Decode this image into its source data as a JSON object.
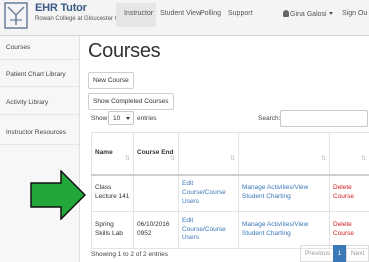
{
  "app": {
    "title": "EHR Tutor",
    "subtitle": "Rowan College at Gloucester County"
  },
  "topnav": {
    "instructor": "Instructor",
    "student_view": "Student View",
    "polling": "Polling",
    "support": "Support",
    "user_name": "Gina Galosi",
    "sign_out": "Sign Ou"
  },
  "sidebar": {
    "items": [
      {
        "label": "Courses"
      },
      {
        "label": "Patient Chart Library"
      },
      {
        "label": "Activity Library"
      },
      {
        "label": "Instructor Resources"
      }
    ]
  },
  "main": {
    "title": "Courses",
    "new_course_label": "New Course",
    "show_completed_label": "Show Completed Courses",
    "show_label": "Show",
    "entries_value": "10",
    "entries_label": "entries",
    "search_label": "Search:",
    "search_value": ""
  },
  "table": {
    "headers": [
      "Name",
      "Course End",
      "",
      "",
      ""
    ],
    "rows": [
      {
        "name": "Class Lecture 141",
        "end": "",
        "edit": "Edit Course/Course Users",
        "manage": "Manage Activities/View Student Charting",
        "delete": "Delete Course"
      },
      {
        "name": "Spring Skills Lab",
        "end": "06/10/2016 0952",
        "edit": "Edit Course/Course Users",
        "manage": "Manage Activities/View Student Charting",
        "delete": "Delete Course"
      }
    ]
  },
  "footer": {
    "info": "Showing 1 to 2 of 2 entries",
    "previous": "Previous",
    "page": "1",
    "next": "Next"
  },
  "colors": {
    "link": "#3978b8",
    "delete": "#cf2020",
    "arrow": "#22a83a",
    "page_active": "#3a78b8"
  }
}
